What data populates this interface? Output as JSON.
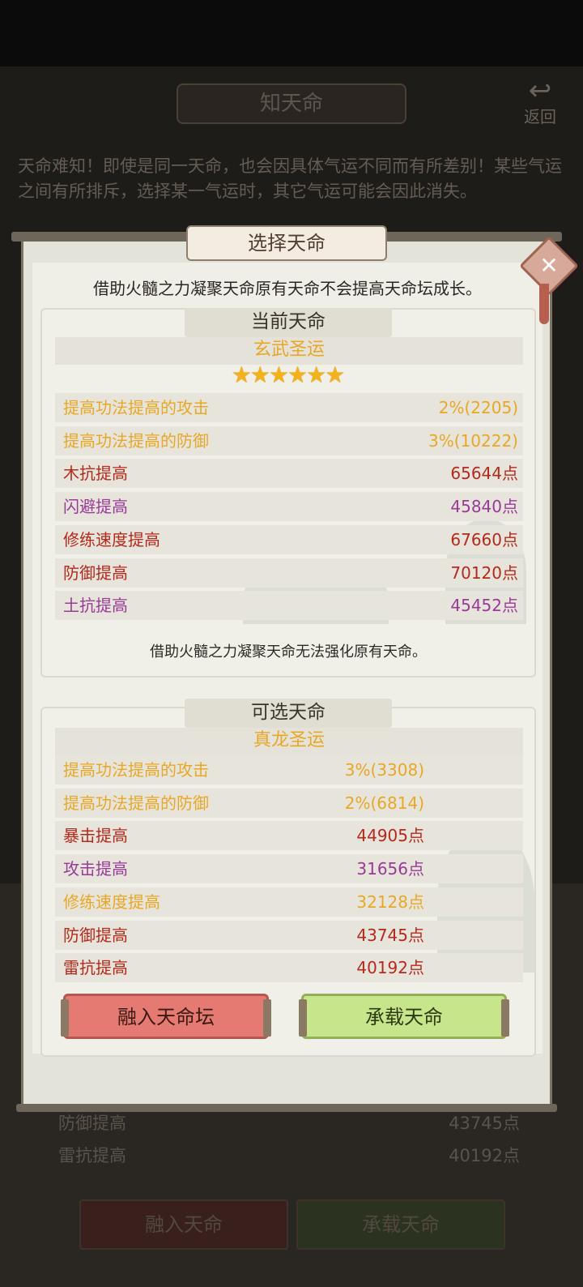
{
  "background": {
    "title": "知天命",
    "back_label": "返回",
    "description": "天命难知！即使是同一天命，也会因具体气运不同而有所差别！某些气运之间有所排斥，选择某一气运时，其它气运可能会因此消失。",
    "rows": [
      {
        "label": "防御提高",
        "value": "43745点"
      },
      {
        "label": "雷抗提高",
        "value": "40192点"
      }
    ],
    "buttons": {
      "fuse": "融入天命",
      "bear": "承载天命"
    }
  },
  "modal": {
    "title": "选择天命",
    "notice": "借助火髓之力凝聚天命原有天命不会提高天命坛成长。",
    "current": {
      "header": "当前天命",
      "name": "玄武圣运",
      "stars": "★★★★★★",
      "star_count": 6,
      "rows": [
        {
          "label": "提高功法提高的攻击",
          "value": "2%(2205)",
          "color": "gold"
        },
        {
          "label": "提高功法提高的防御",
          "value": "3%(10222)",
          "color": "gold"
        },
        {
          "label": "木抗提高",
          "value": "65644点",
          "color": "red"
        },
        {
          "label": "闪避提高",
          "value": "45840点",
          "color": "purple"
        },
        {
          "label": "修练速度提高",
          "value": "67660点",
          "color": "red"
        },
        {
          "label": "防御提高",
          "value": "70120点",
          "color": "red"
        },
        {
          "label": "土抗提高",
          "value": "45452点",
          "color": "purple"
        }
      ],
      "footnote": "借助火髓之力凝聚天命无法强化原有天命。"
    },
    "optional": {
      "header": "可选天命",
      "name": "真龙圣运",
      "rows": [
        {
          "label": "提高功法提高的攻击",
          "value": "3%(3308)",
          "color": "gold"
        },
        {
          "label": "提高功法提高的防御",
          "value": "2%(6814)",
          "color": "gold"
        },
        {
          "label": "暴击提高",
          "value": "44905点",
          "color": "red"
        },
        {
          "label": "攻击提高",
          "value": "31656点",
          "color": "purple"
        },
        {
          "label": "修练速度提高",
          "value": "32128点",
          "color": "gold"
        },
        {
          "label": "防御提高",
          "value": "43745点",
          "color": "red"
        },
        {
          "label": "雷抗提高",
          "value": "40192点",
          "color": "red"
        }
      ]
    },
    "buttons": {
      "fuse": "融入天命坛",
      "bear": "承载天命"
    },
    "close_icon": "close-icon"
  },
  "colors": {
    "gold": "#e9a726",
    "red": "#b8281b",
    "purple": "#9a3a98"
  }
}
